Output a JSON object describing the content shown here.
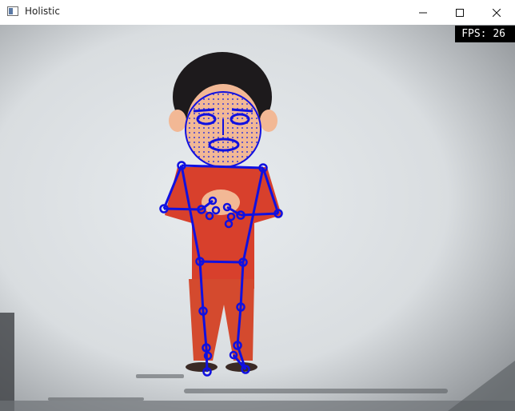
{
  "window": {
    "title": "Holistic",
    "minimize_icon": "minimize-icon",
    "maximize_icon": "maximize-icon",
    "close_icon": "close-icon"
  },
  "overlay": {
    "fps_text": "FPS: 26"
  },
  "colors": {
    "landmark_blue": "#1010e0",
    "shirt_red": "#d8402c",
    "face_skin": "#f2b895"
  }
}
